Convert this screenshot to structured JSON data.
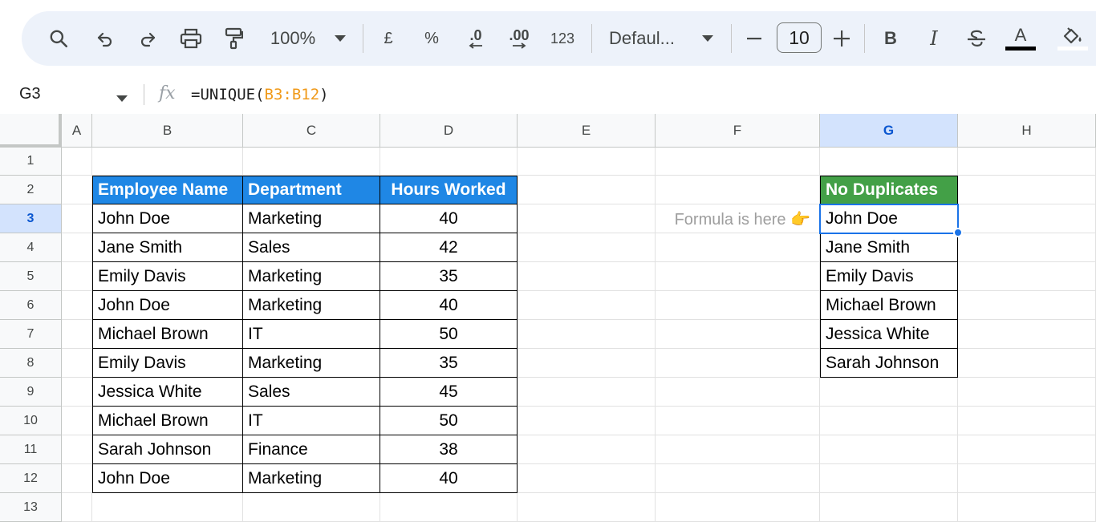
{
  "toolbar": {
    "zoom": "100%",
    "currency": "£",
    "percent": "%",
    "decrease_decimal": ".0",
    "increase_decimal": ".00",
    "number_format": "123",
    "font": "Defaul...",
    "font_size": "10",
    "bold": "B",
    "italic": "I",
    "text_color": "A",
    "text_color_value": "#000000"
  },
  "formula_bar": {
    "cell_ref": "G3",
    "fx": "fx",
    "formula_prefix": "=UNIQUE(",
    "formula_range": "B3:B12",
    "formula_suffix": ")"
  },
  "columns": [
    "A",
    "B",
    "C",
    "D",
    "E",
    "F",
    "G",
    "H"
  ],
  "selected_column": "G",
  "rows": [
    "1",
    "2",
    "3",
    "4",
    "5",
    "6",
    "7",
    "8",
    "9",
    "10",
    "11",
    "12",
    "13"
  ],
  "selected_row": "3",
  "table": {
    "headers": [
      "Employee Name",
      "Department",
      "Hours Worked"
    ],
    "header_color": "#1f87e5",
    "rows": [
      [
        "John Doe",
        "Marketing",
        "40"
      ],
      [
        "Jane Smith",
        "Sales",
        "42"
      ],
      [
        "Emily Davis",
        "Marketing",
        "35"
      ],
      [
        "John Doe",
        "Marketing",
        "40"
      ],
      [
        "Michael Brown",
        "IT",
        "50"
      ],
      [
        "Emily Davis",
        "Marketing",
        "35"
      ],
      [
        "Jessica White",
        "Sales",
        "45"
      ],
      [
        "Michael Brown",
        "IT",
        "50"
      ],
      [
        "Sarah Johnson",
        "Finance",
        "38"
      ],
      [
        "John Doe",
        "Marketing",
        "40"
      ]
    ]
  },
  "note": "Formula is here 👉",
  "unique_list": {
    "header": "No Duplicates",
    "header_color": "#43a047",
    "values": [
      "John Doe",
      "Jane Smith",
      "Emily Davis",
      "Michael Brown",
      "Jessica White",
      "Sarah Johnson"
    ]
  },
  "icons": {
    "search": "search-icon",
    "undo": "undo-icon",
    "redo": "redo-icon",
    "print": "print-icon",
    "paint_format": "paint-format-icon",
    "zoom_dropdown": "chevron-down-icon",
    "font_dropdown": "chevron-down-icon",
    "minus": "minus-icon",
    "plus": "plus-icon",
    "strikethrough": "strikethrough-icon",
    "fill_color": "fill-color-icon"
  }
}
